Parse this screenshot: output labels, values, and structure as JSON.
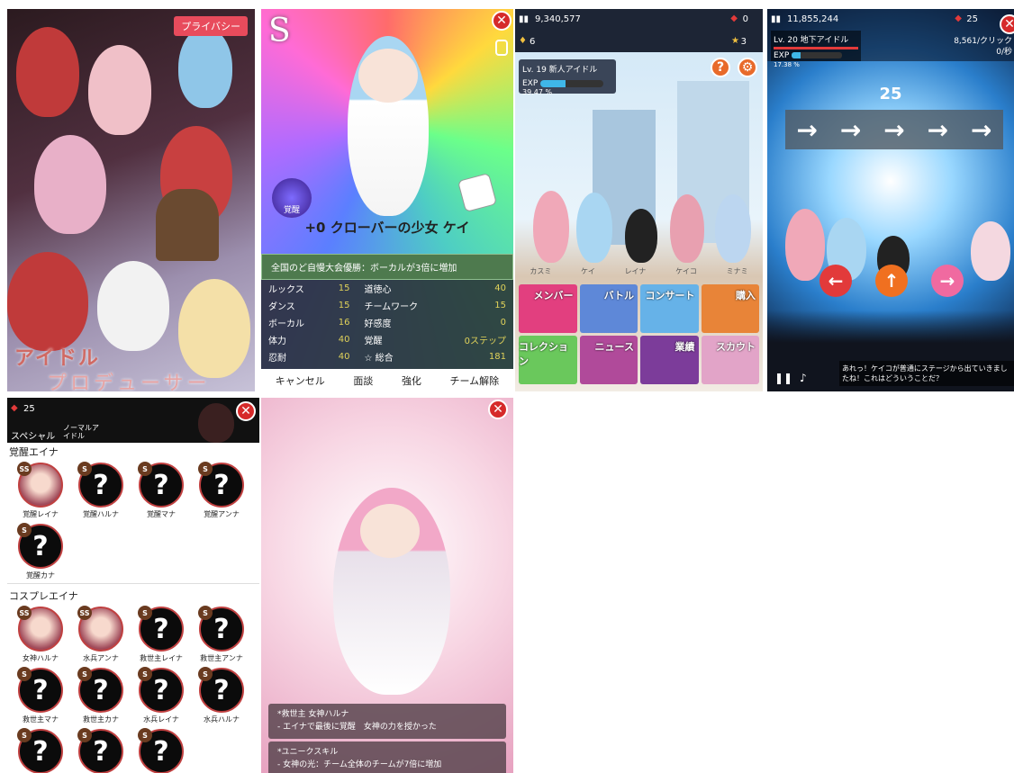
{
  "p1": {
    "privacy": "プライバシー",
    "title1": "アイドル",
    "title2": "プロデューサー"
  },
  "p2": {
    "rank": "S",
    "level_name": "+0 クローバーの少女 ケイ",
    "awaken": "覚醒",
    "bonus": "全国のど自慢大会優勝：ボーカルが3倍に増加",
    "stats": [
      [
        "ルックス",
        "15",
        "道徳心",
        "40"
      ],
      [
        "ダンス",
        "15",
        "チームワーク",
        "15"
      ],
      [
        "ボーカル",
        "16",
        "好感度",
        "0"
      ],
      [
        "体力",
        "40",
        "覚醒",
        "0ステップ"
      ],
      [
        "忍耐",
        "40",
        "☆ 総合",
        "181"
      ]
    ],
    "buttons": [
      "キャンセル",
      "面談",
      "強化",
      "チーム解除"
    ]
  },
  "p3": {
    "money": "9,340,577",
    "gems": "0",
    "trophy": "6",
    "stars": "3",
    "level": "Lv. 19 新人アイドル",
    "exp_label": "EXP",
    "exp": "39.47 %",
    "exp_fraction": 0.3947,
    "names": [
      "カスミ",
      "ケイ",
      "レイナ",
      "ケイコ",
      "ミナミ"
    ],
    "tiles": [
      {
        "l": "メンバー",
        "c": "#e23f7f"
      },
      {
        "l": "バトル",
        "c": "#5e88d8"
      },
      {
        "l": "コンサート",
        "c": "#66b2e8"
      },
      {
        "l": "購入",
        "c": "#e88438"
      },
      {
        "l": "コレクション",
        "c": "#6ac85c"
      },
      {
        "l": "ニュース",
        "c": "#b04a9a"
      },
      {
        "l": "業績",
        "c": "#7c3c9a"
      },
      {
        "l": "スカウト",
        "c": "#e2a4c8"
      }
    ]
  },
  "p4": {
    "money": "11,855,244",
    "gems": "25",
    "level": "Lv. 20 地下アイドル",
    "exp_label": "EXP",
    "exp": "17.38 %",
    "exp_fraction": 0.1738,
    "rate": "8,561/クリック",
    "rate2": "0/秒",
    "combo": "25",
    "message": "あれっ！ケイコが普通にステージから出ていきましたね！これはどういうことだ？"
  },
  "p5": {
    "gems": "25",
    "tab1": "スペシャル",
    "tab2": "ノーマルア\nイドル",
    "sec1": "覚醒エイナ",
    "sec2": "コスプレエイナ",
    "awk": [
      [
        "SS",
        "覚醒レイナ",
        true
      ],
      [
        "S",
        "覚醒ハルナ",
        false
      ],
      [
        "S",
        "覚醒マナ",
        false
      ],
      [
        "S",
        "覚醒アンナ",
        false
      ],
      [
        "S",
        "覚醒カナ",
        false
      ]
    ],
    "cos": [
      [
        "SS",
        "女神ハルナ",
        true
      ],
      [
        "SS",
        "水兵アンナ",
        true
      ],
      [
        "S",
        "救世主レイナ",
        false
      ],
      [
        "S",
        "救世主アンナ",
        false
      ],
      [
        "S",
        "救世主マナ",
        false
      ],
      [
        "S",
        "救世主カナ",
        false
      ],
      [
        "S",
        "水兵レイナ",
        false
      ],
      [
        "S",
        "水兵ハルナ",
        false
      ],
      [
        "S",
        "",
        false
      ],
      [
        "S",
        "",
        false
      ],
      [
        "S",
        "",
        false
      ]
    ]
  },
  "p6": {
    "t1": "*救世主 女神ハルナ",
    "d1": "- エイナで最後に覚醒　女神の力を授かった",
    "t2": "*ユニークスキル",
    "d2": "- 女神の光：チーム全体のチームが7倍に増加"
  }
}
